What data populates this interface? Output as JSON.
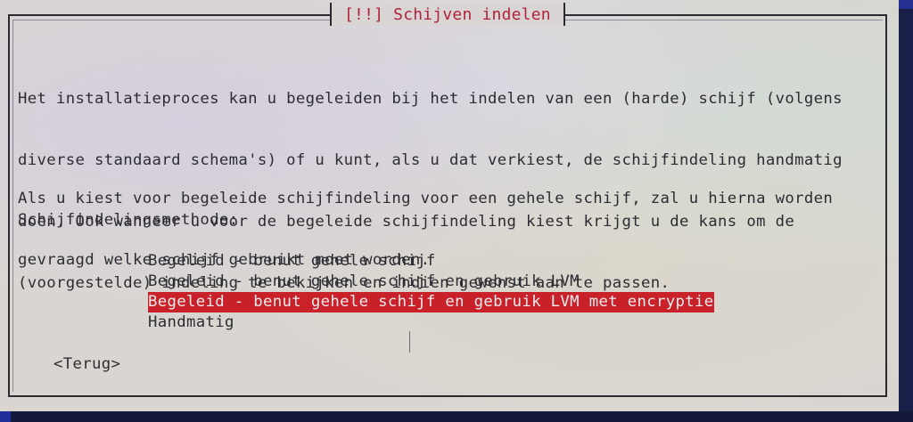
{
  "dialog": {
    "title": "[!!] Schijven indelen",
    "paragraph1": [
      "Het installatieproces kan u begeleiden bij het indelen van een (harde) schijf (volgens",
      "diverse standaard schema's) of u kunt, als u dat verkiest, de schijfindeling handmatig",
      "doen. Ook wanneer u voor de begeleide schijfindeling kiest krijgt u de kans om de",
      "(voorgestelde) indeling te bekijken en indien gewenst aan te passen."
    ],
    "paragraph2": [
      "Als u kiest voor begeleide schijfindeling voor een gehele schijf, zal u hierna worden",
      "gevraagd welke schijf gebruikt moet worden."
    ],
    "method_label": "Schijfindelingsmethode:",
    "options": [
      {
        "label": "Begeleid - benut gehele schijf",
        "selected": false
      },
      {
        "label": "Begeleid - benut gehele schijf en gebruik LVM",
        "selected": false
      },
      {
        "label": "Begeleid - benut gehele schijf en gebruik LVM met encryptie",
        "selected": true
      },
      {
        "label": "Handmatig",
        "selected": false
      }
    ],
    "back_label": "<Terug>"
  },
  "colors": {
    "background": "#2233a8",
    "dialog": "#d9d6d2",
    "title_text": "#b2223a",
    "selection": "#c8212a"
  }
}
